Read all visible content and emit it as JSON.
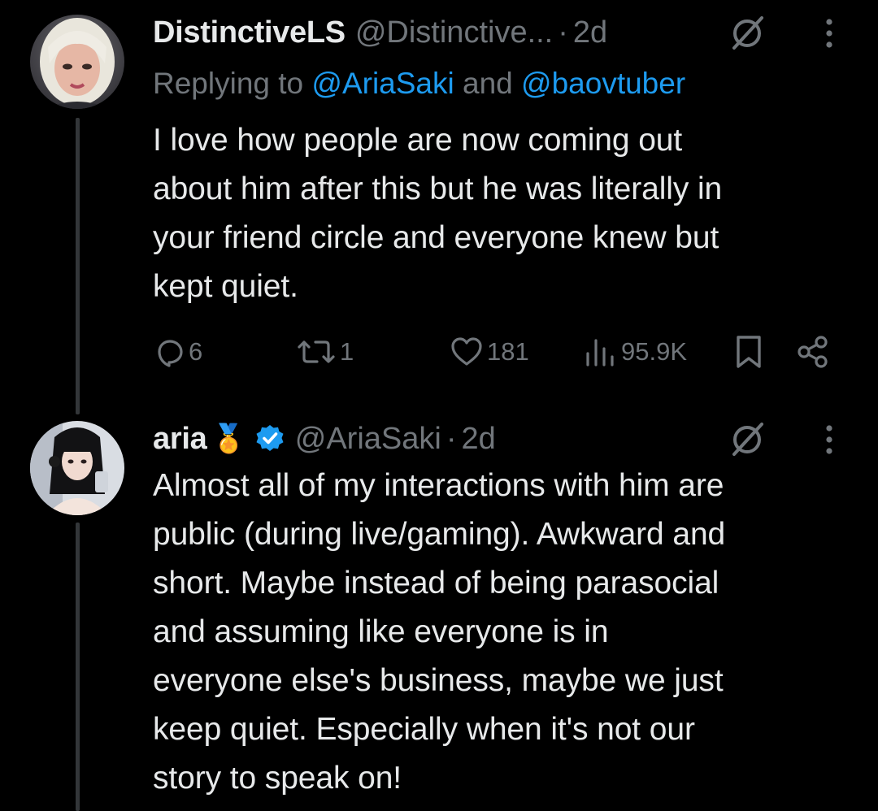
{
  "tweets": [
    {
      "name": "DistinctiveLS",
      "handle": "@Distinctive...",
      "separator": "·",
      "time": "2d",
      "replying_prefix": "Replying to ",
      "mention_1": "@AriaSaki",
      "replying_join": " and ",
      "mention_2": "@baovtuber",
      "text": "I love how people are now coming out\nabout him after this but he was literally in\nyour friend circle and everyone knew but\nkept quiet.",
      "replies": "6",
      "reposts": "1",
      "likes": "181",
      "views": "95.9K"
    },
    {
      "name": "aria",
      "badge_emoji": "🏅",
      "verified": true,
      "handle": "@AriaSaki",
      "separator": "·",
      "time": "2d",
      "text": "Almost all of my interactions with him are\npublic (during live/gaming). Awkward and\nshort. Maybe instead of being parasocial\nand assuming like everyone is in\neveryone else's business, maybe we just\nkeep quiet. Especially when it's not our\nstory to speak on!"
    }
  ],
  "colors": {
    "background": "#000000",
    "primary_text": "#e7e9ea",
    "secondary_text": "#71767b",
    "link": "#1d9bf0",
    "verified": "#1d9bf0",
    "thread_line": "#333639"
  },
  "icons": {
    "reply": "speech-bubble-icon",
    "repost": "repost-arrows-icon",
    "like": "heart-icon",
    "views": "bar-chart-icon",
    "bookmark": "bookmark-icon",
    "share": "share-icon",
    "grok": "grok-slash-circle-icon",
    "more": "vertical-ellipsis-icon"
  }
}
